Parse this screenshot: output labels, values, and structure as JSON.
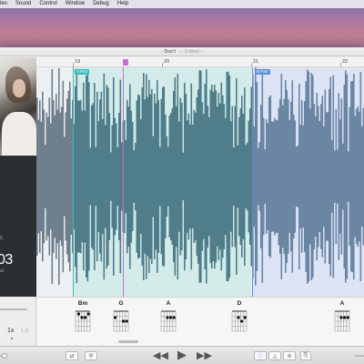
{
  "menubar": {
    "items": [
      "tes",
      "Sound",
      "Control",
      "Window",
      "Debug",
      "Help"
    ]
  },
  "window": {
    "title": "Don't",
    "edited": "— Edited ~"
  },
  "sidebar": {
    "time_small": "0",
    "time_big": "03",
    "time_sub": "al",
    "speed_label": "1x",
    "speed_alt": "1.5"
  },
  "ruler": {
    "numbers": [
      "19",
      "20",
      "21",
      "22"
    ]
  },
  "markers": {
    "a_part": "A Part",
    "b_part": "B Part"
  },
  "chords": [
    "Bm",
    "G",
    "A",
    "D",
    "A"
  ],
  "colors": {
    "wave_dim": "#6f7f8c",
    "wave_a": "#4f7d8a",
    "wave_b": "#6b86a3",
    "region_a": "#d3ece9",
    "region_b": "#dde4f5",
    "marker_a": "#3fb8b8",
    "marker_b": "#5b8fd6",
    "playhead": "#c96bd6"
  },
  "toolbar": {
    "left_btn1_icon": "loop-icon",
    "left_btn2_icon": "tuning-fork-icon",
    "rewind_icon": "rewind-icon",
    "play_icon": "play-icon",
    "forward_icon": "fast-forward-icon",
    "right_btn1_icon": "info-icon",
    "right_btn2_icon": "metronome-icon",
    "right_btn3_icon": "eq-icon",
    "right_btn4_icon": "export-icon"
  }
}
